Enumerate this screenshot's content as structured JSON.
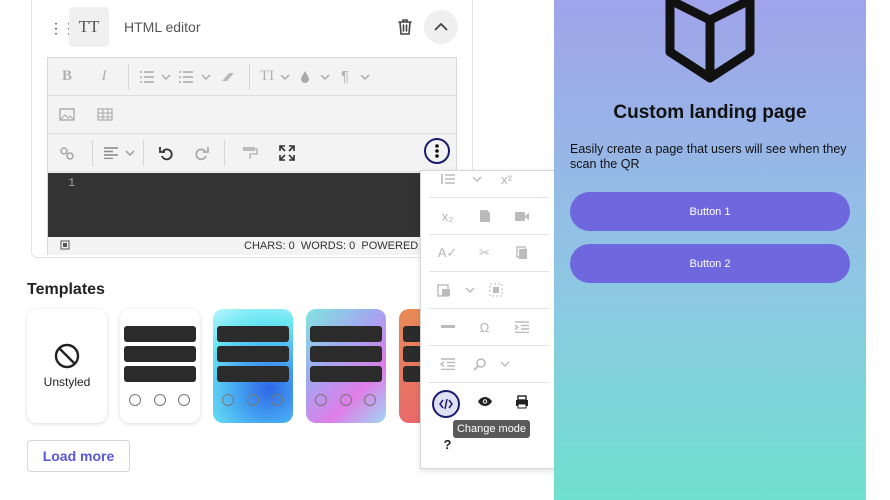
{
  "block": {
    "title": "HTML editor",
    "type_glyph": "TT"
  },
  "editor": {
    "line_number": "1",
    "status": {
      "chars": "CHARS: 0",
      "words": "WORDS: 0",
      "powered_by": "POWERED BY"
    }
  },
  "overflow_menu": {
    "tooltip": "Change mode",
    "help_label": "?"
  },
  "templates": {
    "heading": "Templates",
    "unstyled_label": "Unstyled",
    "load_more_label": "Load more"
  },
  "preview": {
    "title": "Custom landing page",
    "description": "Easily create a page that users will see when they scan the QR",
    "button1": "Button 1",
    "button2": "Button 2",
    "accent_color": "#6f67dd"
  }
}
